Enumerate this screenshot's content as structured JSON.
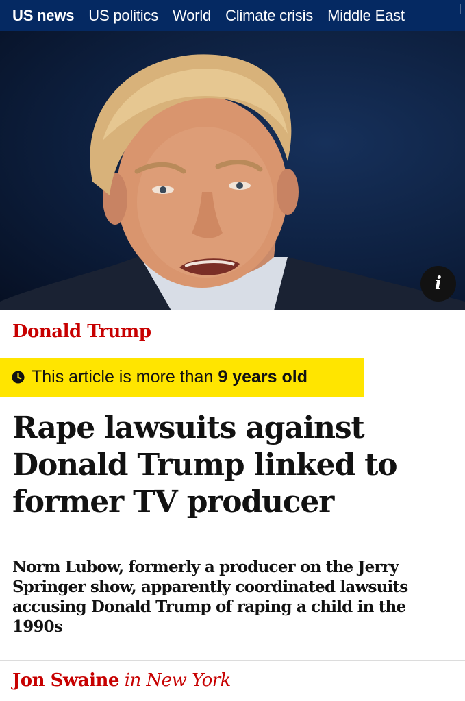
{
  "nav": {
    "items": [
      "US news",
      "US politics",
      "World",
      "Climate crisis",
      "Middle East"
    ],
    "active_index": 0,
    "colors": {
      "background": "#052962",
      "text": "#ffffff"
    }
  },
  "hero": {
    "info_icon": "i"
  },
  "article": {
    "kicker": "Donald Trump",
    "age_warning": {
      "prefix": "This article is more than",
      "emphasis": "9 years old",
      "icon": "clock-icon",
      "background": "#ffe500"
    },
    "headline": "Rape lawsuits against Donald Trump linked to former TV producer",
    "standfirst": "Norm Lubow, formerly a producer on the Jerry Springer show, apparently coordinated lawsuits accusing Donald Trump of raping a child in the 1990s",
    "byline": {
      "name": "Jon Swaine",
      "location": "in New York"
    },
    "accent_color": "#c70000"
  }
}
